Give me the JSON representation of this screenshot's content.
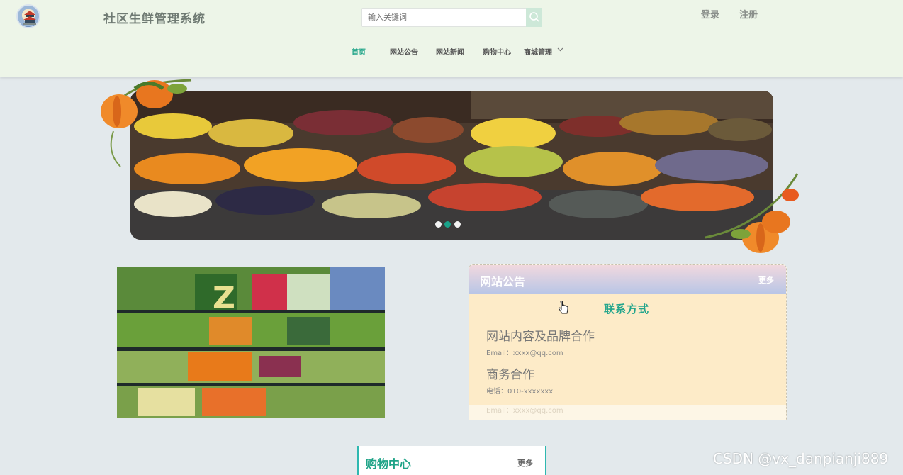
{
  "header": {
    "site_title": "社区生鲜管理系统",
    "search_placeholder": "输入关键词",
    "login": "登录",
    "register": "注册"
  },
  "nav": {
    "items": [
      {
        "label": "首页",
        "active": true
      },
      {
        "label": "网站公告",
        "active": false
      },
      {
        "label": "网站新闻",
        "active": false
      },
      {
        "label": "购物中心",
        "active": false
      },
      {
        "label": "商城管理",
        "active": false,
        "has_dropdown": true
      }
    ]
  },
  "banner": {
    "slide_count": 3,
    "active_slide": 2
  },
  "notice": {
    "title": "网站公告",
    "more": "更多",
    "contact_title": "联系方式",
    "section1_heading": "网站内容及品牌合作",
    "section1_email": "Email：xxxx@qq.com",
    "section2_heading": "商务合作",
    "section2_phone": "电话：010-xxxxxxx",
    "section2_email": "Email：xxxx@qq.com"
  },
  "shop": {
    "title": "购物中心",
    "more": "更多"
  },
  "watermark": "CSDN @vx_danpianji889",
  "colors": {
    "accent": "#1ea387",
    "header_bg": "#edf5e8",
    "page_bg": "#e3e9ec"
  }
}
